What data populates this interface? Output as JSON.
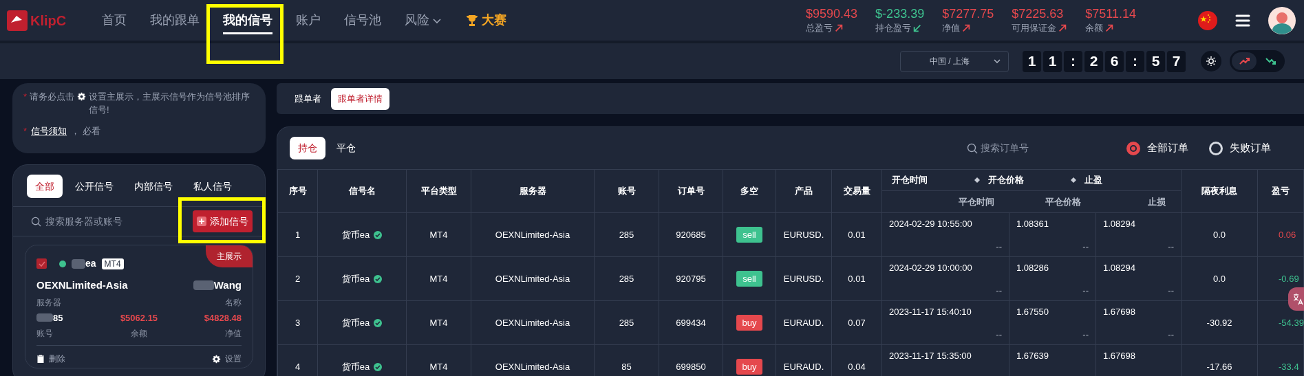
{
  "brand": {
    "logo": "KlipC"
  },
  "nav": [
    {
      "label": "首页",
      "kind": "link",
      "selected": false,
      "highlighted": false
    },
    {
      "label": "我的跟单",
      "kind": "link",
      "selected": false,
      "highlighted": false
    },
    {
      "label": "我的信号",
      "kind": "link",
      "selected": true,
      "highlighted": true
    },
    {
      "label": "账户",
      "kind": "link",
      "selected": false,
      "highlighted": false
    },
    {
      "label": "信号池",
      "kind": "link",
      "selected": false,
      "highlighted": false
    },
    {
      "label": "风险",
      "kind": "dropdown",
      "selected": false,
      "highlighted": false
    },
    {
      "label": "大赛",
      "kind": "contest",
      "selected": false,
      "highlighted": false
    }
  ],
  "stats": [
    {
      "value": "$9590.43",
      "label": "总盈亏",
      "rising": true
    },
    {
      "value": "$-233.39",
      "label": "持仓盈亏",
      "rising": false
    },
    {
      "value": "$7277.75",
      "label": "净值",
      "rising": true
    },
    {
      "value": "$7225.63",
      "label": "可用保证金",
      "rising": true
    },
    {
      "value": "$7511.14",
      "label": "余额",
      "rising": true
    }
  ],
  "region_select": {
    "value": "中国 / 上海"
  },
  "clock": [
    "1",
    "1",
    ":",
    "2",
    "6",
    ":",
    "5",
    "7"
  ],
  "trend_toggle": [
    {
      "kind": "up",
      "selected": true
    },
    {
      "kind": "down",
      "selected": false
    }
  ],
  "notice": {
    "marker": "*",
    "text_before_icon": "请务必点击",
    "text_after_icon": "设置主展示，主展示信号作为信号池排序信号!",
    "link_marker": "*",
    "link": "信号须知",
    "link_suffix": "， 必看"
  },
  "signal_tabs": [
    {
      "label": "全部",
      "selected": true
    },
    {
      "label": "公开信号",
      "selected": false
    },
    {
      "label": "内部信号",
      "selected": false
    },
    {
      "label": "私人信号",
      "selected": false
    }
  ],
  "signal_search": {
    "placeholder": "搜索服务器或账号"
  },
  "add_button": {
    "label": "添加信号",
    "highlighted": true
  },
  "signal_card": {
    "checked": true,
    "name": "ea",
    "platform": "MT4",
    "badge": "主展示",
    "server": "OEXNLimited-Asia",
    "server_label": "服务器",
    "owner": "Wang",
    "owner_label": "名称",
    "account": "85",
    "account_label": "账号",
    "balance": "$5062.15",
    "balance_label": "余额",
    "equity": "$4828.48",
    "equity_label": "净值",
    "actions": [
      {
        "kind": "delete",
        "label": "删除"
      },
      {
        "kind": "settings",
        "label": "设置"
      }
    ]
  },
  "main_tabs": [
    {
      "label": "跟单者",
      "selected": false
    },
    {
      "label": "跟单者详情",
      "selected": true
    }
  ],
  "position_tabs": [
    {
      "label": "持仓",
      "selected": true
    },
    {
      "label": "平仓",
      "selected": false
    }
  ],
  "order_search": {
    "placeholder": "搜索订单号"
  },
  "order_filter": [
    {
      "label": "全部订单",
      "selected": true
    },
    {
      "label": "失败订单",
      "selected": false
    }
  ],
  "table": {
    "columns": [
      "序号",
      "信号名",
      "平台类型",
      "服务器",
      "账号",
      "订单号",
      "多空",
      "产品",
      "交易量"
    ],
    "group_top": [
      "开仓时间",
      "开仓价格",
      "止盈"
    ],
    "group_bottom": [
      "平仓时间",
      "平仓价格",
      "止损"
    ],
    "tail_columns": [
      "隔夜利息",
      "盈亏"
    ],
    "rows": [
      {
        "index": "1",
        "signal": "货币ea",
        "verified": true,
        "platform": "MT4",
        "server": "OEXNLimited-Asia",
        "account": "285",
        "order_prefix": "920",
        "order_suffix": "685",
        "side": "sell",
        "symbol": "EURUSD.",
        "volume": "0.01",
        "open_time": "2024-02-29 10:55:00",
        "close_time": "--",
        "open_price": "1.08361",
        "close_price": "--",
        "take_profit": "1.08294",
        "stop_loss": "--",
        "swap": "0.0",
        "pl": "0.06",
        "profit": true
      },
      {
        "index": "2",
        "signal": "货币ea",
        "verified": true,
        "platform": "MT4",
        "server": "OEXNLimited-Asia",
        "account": "285",
        "order_prefix": "920",
        "order_suffix": "795",
        "side": "sell",
        "symbol": "EURUSD.",
        "volume": "0.01",
        "open_time": "2024-02-29 10:00:00",
        "close_time": "--",
        "open_price": "1.08286",
        "close_price": "--",
        "take_profit": "1.08294",
        "stop_loss": "--",
        "swap": "0.0",
        "pl": "-0.69",
        "profit": false
      },
      {
        "index": "3",
        "signal": "货币ea",
        "verified": true,
        "platform": "MT4",
        "server": "OEXNLimited-Asia",
        "account": "285",
        "order_prefix": "699",
        "order_suffix": "434",
        "side": "buy",
        "symbol": "EURAUD.",
        "volume": "0.07",
        "open_time": "2023-11-17 15:40:10",
        "close_time": "--",
        "open_price": "1.67550",
        "close_price": "--",
        "take_profit": "1.67698",
        "stop_loss": "--",
        "swap": "-30.92",
        "pl": "-54.39",
        "profit": false
      },
      {
        "index": "4",
        "signal": "货币ea",
        "verified": true,
        "platform": "MT4",
        "server": "OEXNLimited-Asia",
        "account": "85",
        "order_prefix": "6998",
        "order_suffix": "50",
        "side": "buy",
        "symbol": "EURAUD.",
        "volume": "0.04",
        "open_time": "2023-11-17 15:35:00",
        "open_price": "1.67639",
        "take_profit": "1.67698",
        "swap": "-17.66",
        "pl": "-33.4",
        "profit": false
      }
    ]
  }
}
